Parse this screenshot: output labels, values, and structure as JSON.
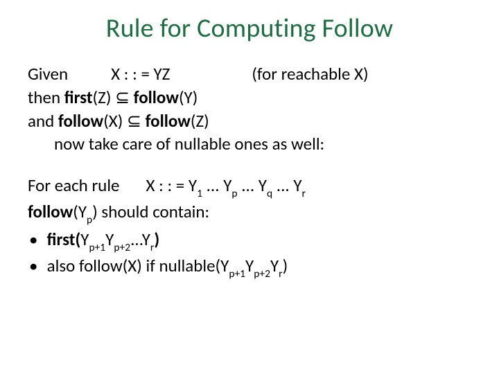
{
  "title": "Rule for Computing Follow",
  "p1": {
    "given": "Given",
    "rule": "X : : = YZ",
    "cond": "(for reachable X)",
    "then": "then ",
    "firstZ": "first",
    "firstZ_arg": "(Z) ",
    "subset1": "⊆ ",
    "followY": "follow",
    "followY_arg": "(Y)",
    "and": "and  ",
    "followX": "follow",
    "followX_arg": "(X) ",
    "subset2": "⊆ ",
    "followZ": "follow",
    "followZ_arg": "(Z)",
    "now": "now take care of nullable ones as well:"
  },
  "p2": {
    "intro": "For each rule",
    "rule_lhs": "X : : = Y",
    "s1": "1",
    "dots": " ... Y",
    "sp": "p",
    "sq": "q",
    "sr": "r",
    "follow": "follow",
    "follow_arg1": "(Y",
    "follow_arg2": ") should contain:",
    "b1_first": "first(",
    "b1_y": "Y",
    "b1_sp1": "p+1",
    "b1_sp2": "p+2",
    "b1_dots": "...Y",
    "b1_sr": "r",
    "b1_close": ")",
    "b2_pre": "also follow(X) if  nullable(Y",
    "b2_sp1": "p+1",
    "b2_y": "Y",
    "b2_sp2": "p+2",
    "b2_sr": "r",
    "b2_close": ")"
  }
}
